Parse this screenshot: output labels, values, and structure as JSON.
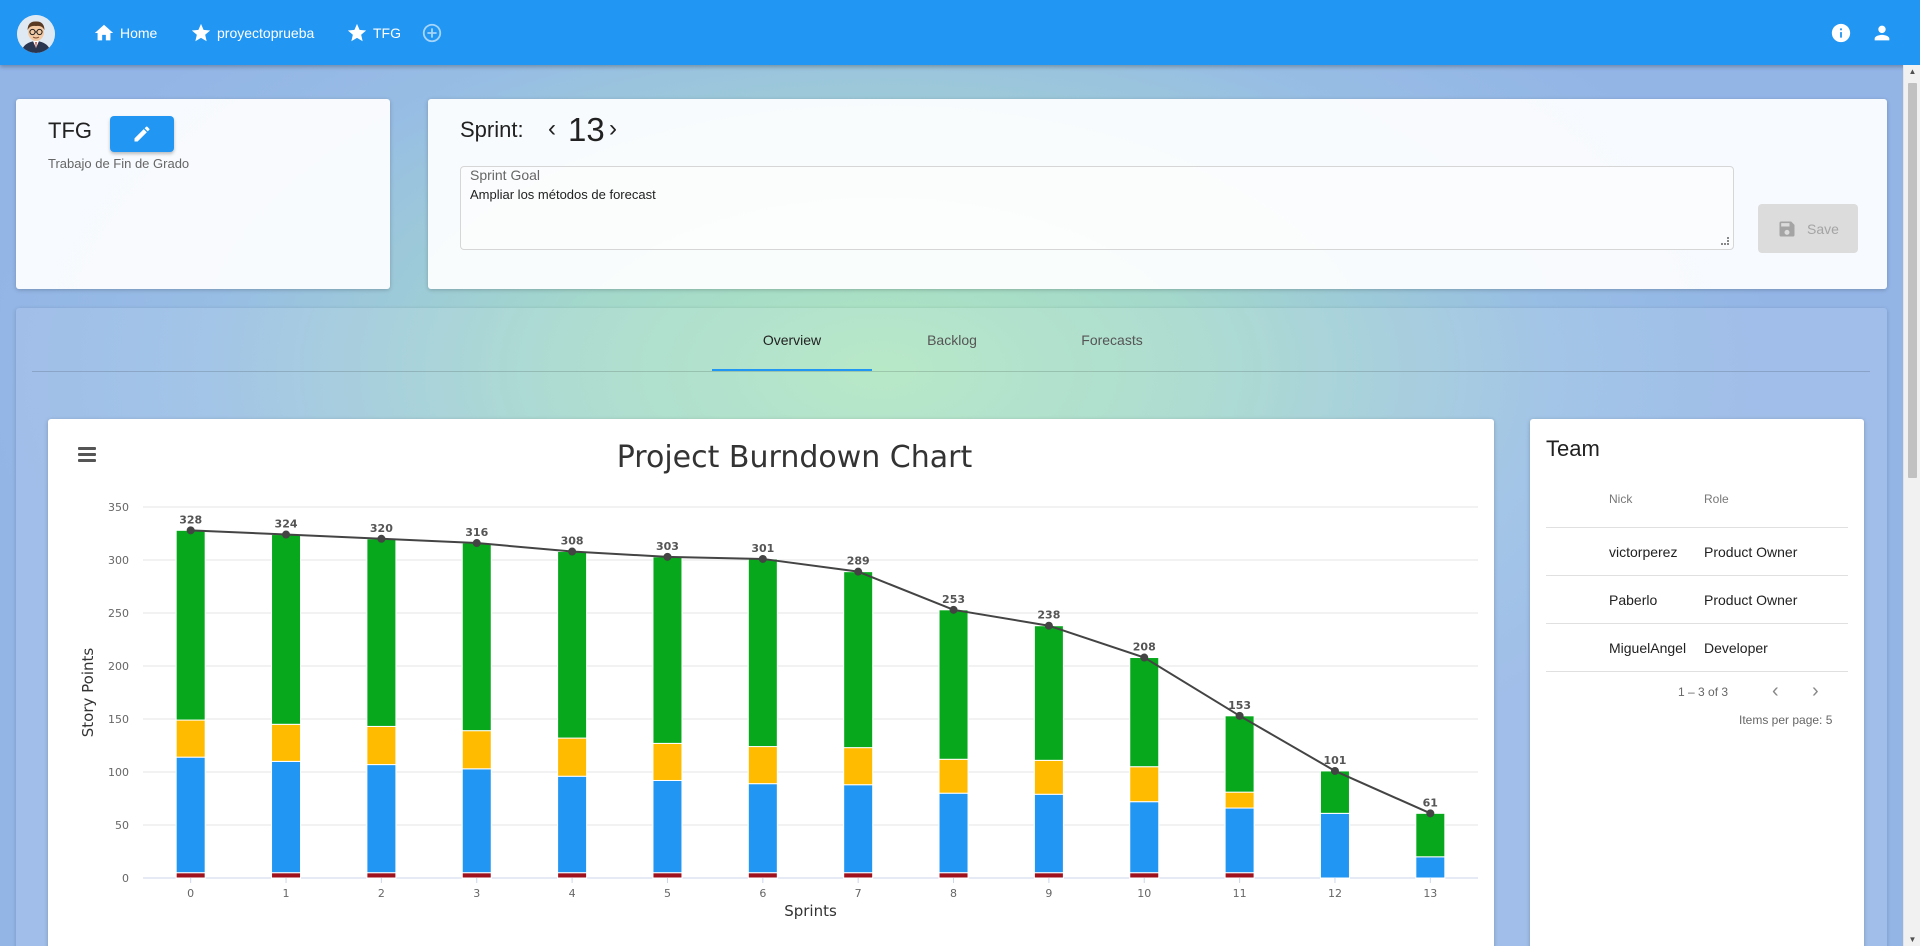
{
  "nav": {
    "items": [
      {
        "label": "Home",
        "icon": "home-icon"
      },
      {
        "label": "proyectoprueba",
        "icon": "star-icon"
      },
      {
        "label": "TFG",
        "icon": "star-icon"
      }
    ],
    "add_icon": "add-circle-icon",
    "right_icons": [
      "info-icon",
      "account-icon"
    ]
  },
  "project": {
    "name": "TFG",
    "description": "Trabajo de Fin de Grado"
  },
  "sprint": {
    "label": "Sprint:",
    "number": "13",
    "goal_label": "Sprint Goal",
    "goal_text": "Ampliar los métodos de forecast",
    "save_label": "Save"
  },
  "tabs": [
    {
      "label": "Overview",
      "active": true
    },
    {
      "label": "Backlog",
      "active": false
    },
    {
      "label": "Forecasts",
      "active": false
    }
  ],
  "chart_data": {
    "type": "bar",
    "title": "Project Burndown Chart",
    "xlabel": "Sprints",
    "ylabel": "Story Points",
    "ylim": [
      0,
      350
    ],
    "yticks": [
      0,
      50,
      100,
      150,
      200,
      250,
      300,
      350
    ],
    "categories": [
      "0",
      "1",
      "2",
      "3",
      "4",
      "5",
      "6",
      "7",
      "8",
      "9",
      "10",
      "11",
      "12",
      "13"
    ],
    "stacked": true,
    "series": [
      {
        "color": "#a0111e",
        "values": [
          5,
          5,
          5,
          5,
          5,
          5,
          5,
          5,
          5,
          5,
          5,
          5,
          0,
          0
        ]
      },
      {
        "color": "#2196f3",
        "values": [
          109,
          105,
          102,
          98,
          91,
          87,
          84,
          83,
          75,
          74,
          67,
          61,
          61,
          20
        ]
      },
      {
        "color": "#ffbb00",
        "values": [
          35,
          35,
          36,
          36,
          36,
          35,
          35,
          35,
          32,
          32,
          33,
          15,
          0,
          0
        ]
      },
      {
        "color": "#07a81c",
        "values": [
          179,
          179,
          177,
          177,
          176,
          176,
          177,
          166,
          141,
          127,
          103,
          72,
          40,
          41
        ]
      }
    ],
    "line": {
      "color": "#444444",
      "values": [
        328,
        324,
        320,
        316,
        308,
        303,
        301,
        289,
        253,
        238,
        208,
        153,
        101,
        61
      ]
    }
  },
  "team": {
    "title": "Team",
    "columns": [
      "Nick",
      "Role"
    ],
    "rows": [
      {
        "nick": "victorperez",
        "role": "Product Owner"
      },
      {
        "nick": "Paberlo",
        "role": "Product Owner"
      },
      {
        "nick": "MiguelAngel",
        "role": "Developer"
      }
    ],
    "range_text": "1 – 3 of 3",
    "items_per_page_label": "Items per page:",
    "items_per_page": "5"
  }
}
